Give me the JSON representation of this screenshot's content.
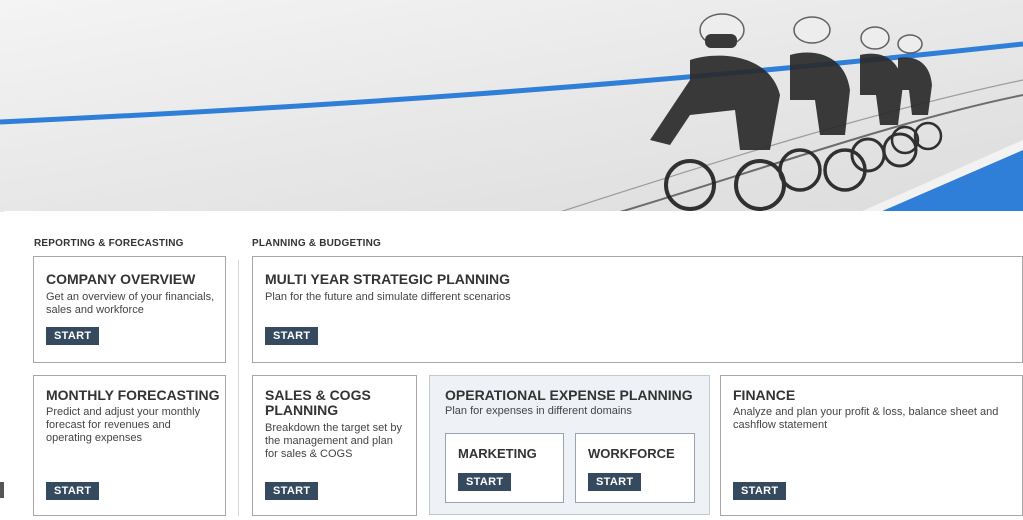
{
  "sections": {
    "reporting": "REPORTING & FORECASTING",
    "planning": "PLANNING & BUDGETING"
  },
  "tiles": {
    "company_overview": {
      "title": "COMPANY OVERVIEW",
      "desc_1": "Get an overview of your financials,",
      "desc_2": "sales and workforce",
      "button": "START"
    },
    "multi_year": {
      "title": "MULTI YEAR STRATEGIC PLANNING",
      "desc": "Plan for the future and simulate different scenarios",
      "button": "START"
    },
    "monthly_forecasting": {
      "title": "MONTHLY FORECASTING",
      "desc_1": "Predict and adjust your monthly",
      "desc_2": "forecast for revenues and",
      "desc_3": "operating expenses",
      "button": "START"
    },
    "sales_cogs": {
      "title_1": "SALES & COGS",
      "title_2": "PLANNING",
      "desc_1": "Breakdown the target set by",
      "desc_2": "the management and plan",
      "desc_3": "for sales & COGS",
      "button": "START"
    },
    "opex": {
      "title": "OPERATIONAL EXPENSE PLANNING",
      "desc": "Plan for expenses in different domains",
      "marketing": {
        "title": "MARKETING",
        "button": "START"
      },
      "workforce": {
        "title": "WORKFORCE",
        "button": "START"
      }
    },
    "finance": {
      "title": "FINANCE",
      "desc_1": "Analyze and plan your profit & loss, balance sheet and",
      "desc_2": "cashflow statement",
      "button": "START"
    }
  },
  "colors": {
    "button_bg": "#354a5f",
    "track_blue": "#2f7fd8",
    "tile_border": "#a7a7a7"
  },
  "hero_image": "track-cycling-team-photo"
}
